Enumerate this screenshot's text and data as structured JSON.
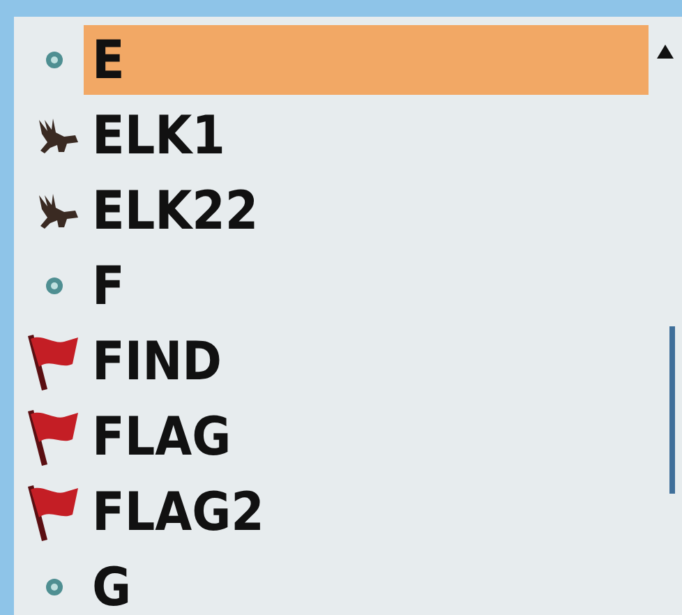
{
  "list": {
    "items": [
      {
        "kind": "dot",
        "label": "E",
        "selected": true
      },
      {
        "kind": "elk",
        "label": "ELK1",
        "selected": false
      },
      {
        "kind": "elk",
        "label": "ELK22",
        "selected": false
      },
      {
        "kind": "dot",
        "label": "F",
        "selected": false
      },
      {
        "kind": "flag",
        "label": "FIND",
        "selected": false
      },
      {
        "kind": "flag",
        "label": "FLAG",
        "selected": false
      },
      {
        "kind": "flag",
        "label": "FLAG2",
        "selected": false
      },
      {
        "kind": "dot",
        "label": "G",
        "selected": false
      }
    ]
  }
}
